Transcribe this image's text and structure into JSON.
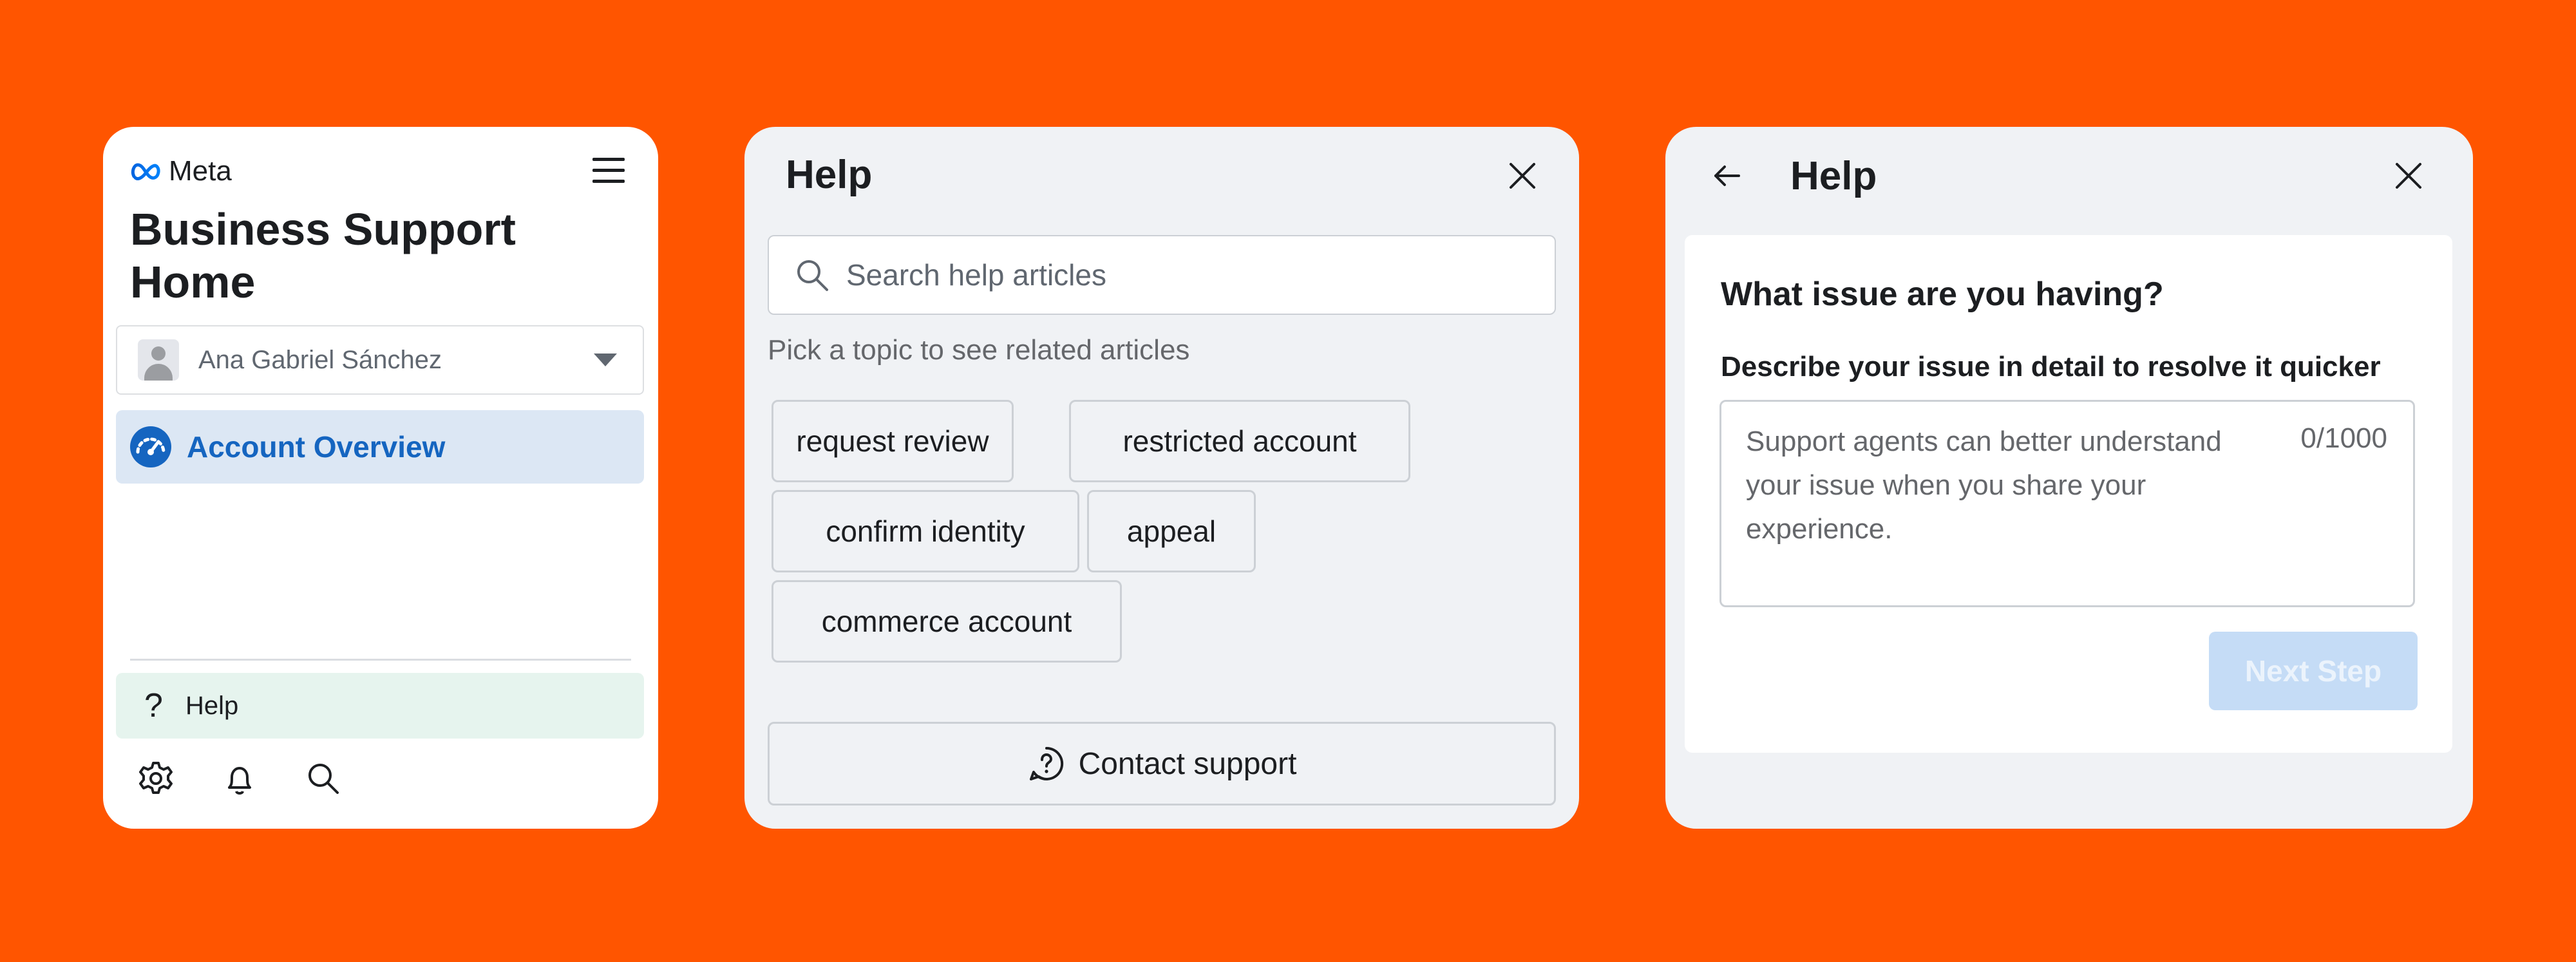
{
  "colors": {
    "background": "#FF5500",
    "accent_blue": "#1565C0",
    "overview_highlight": "#DCE7F4",
    "help_highlight": "#E6F4EE",
    "disabled_button": "#C5DCF6"
  },
  "nav_panel": {
    "logo_text": "Meta",
    "menu_icon": "hamburger-icon",
    "title": "Business Support Home",
    "account_selector": {
      "selected": "Ana Gabriel Sánchez",
      "icon": "chevron-down-icon"
    },
    "items": [
      {
        "label": "Account Overview",
        "icon": "gauge-icon",
        "active": true
      }
    ],
    "help_item": {
      "label": "Help",
      "icon": "question-icon"
    },
    "bottom_icons": [
      "gear-icon",
      "bell-icon",
      "search-icon"
    ]
  },
  "help_topics_panel": {
    "title": "Help",
    "close_icon": "close-icon",
    "search": {
      "value": "",
      "placeholder": "Search help articles"
    },
    "topic_hint": "Pick a topic to see related articles",
    "topics": [
      "request review",
      "restricted account",
      "confirm identity",
      "appeal",
      "commerce account"
    ],
    "contact_button": {
      "label": "Contact support",
      "icon": "help-circle-icon"
    }
  },
  "issue_panel": {
    "title": "Help",
    "back_icon": "arrow-left-icon",
    "close_icon": "close-icon",
    "heading": "What issue are you having?",
    "field_label": "Describe your issue in detail to resolve it quicker",
    "field_value": "",
    "field_placeholder": "Support agents can better understand your issue when you share your experience.",
    "char_count": "0/1000",
    "next_button": {
      "label": "Next Step",
      "disabled": true
    }
  }
}
